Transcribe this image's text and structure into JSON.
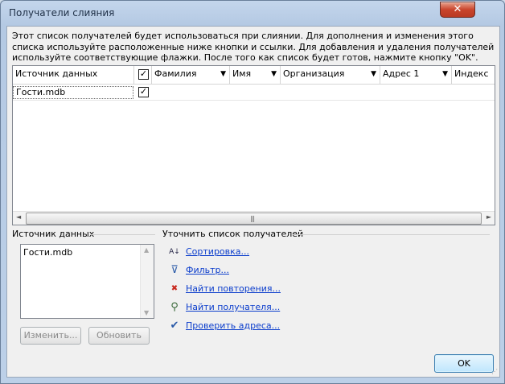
{
  "window": {
    "title": "Получатели слияния",
    "close_label": "✕"
  },
  "intro_text": "Этот список получателей будет использоваться при слиянии. Для дополнения и изменения этого списка используйте расположенные ниже кнопки и ссылки. Для добавления и удаления получателей используйте соответствующие флажки. После того как список будет готов, нажмите кнопку \"OK\".",
  "grid": {
    "columns": [
      {
        "label": "Источник данных",
        "dropdown": false
      },
      {
        "label": "✓",
        "dropdown": false,
        "checkbox": true
      },
      {
        "label": "Фамилия",
        "dropdown": true
      },
      {
        "label": "Имя",
        "dropdown": true
      },
      {
        "label": "Организация",
        "dropdown": true
      },
      {
        "label": "Адрес 1",
        "dropdown": true
      },
      {
        "label": "Индекс",
        "dropdown": false
      }
    ],
    "rows": [
      {
        "source": "Гости.mdb",
        "checked": "✓"
      }
    ],
    "dropdown_glyph": "▼",
    "scroll_left": "◄",
    "scroll_right": "►",
    "scroll_grip": "|||"
  },
  "datasource_section": {
    "label": "Источник данных",
    "items": [
      "Гости.mdb"
    ],
    "edit_button": "Изменить...",
    "refresh_button": "Обновить"
  },
  "refine_section": {
    "label": "Уточнить список получателей",
    "links": [
      {
        "icon": "sort-icon",
        "glyph": "A↓",
        "label": "Сортировка..."
      },
      {
        "icon": "filter-icon",
        "glyph": "⊽",
        "label": "Фильтр..."
      },
      {
        "icon": "duplicates-icon",
        "glyph": "✖",
        "label": "Найти повторения..."
      },
      {
        "icon": "find-recipient-icon",
        "glyph": "⚲",
        "label": "Найти получателя..."
      },
      {
        "icon": "validate-addresses-icon",
        "glyph": "✔",
        "label": "Проверить адреса..."
      }
    ]
  },
  "ok_button": "OK",
  "colors": {
    "link": "#0b3dcc",
    "close": "#c9452c",
    "ok_border": "#3c7fb1"
  }
}
